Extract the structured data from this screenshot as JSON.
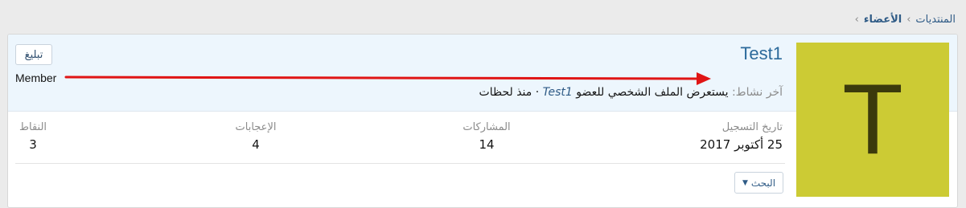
{
  "breadcrumb": {
    "items": [
      {
        "label": "المنتديات"
      },
      {
        "label": "الأعضاء"
      }
    ],
    "separator": "›"
  },
  "profile": {
    "avatar_letter": "T",
    "avatar_color": "#cccb34",
    "username": "Test1",
    "title": "Member",
    "report_label": "تبليغ",
    "last_activity": {
      "label": "آخر نشاط:",
      "action": "يستعرض الملف الشخصي للعضو",
      "member": "Test1",
      "separator": "·",
      "time": "منذ لحظات"
    }
  },
  "stats": {
    "registered": {
      "label": "تاريخ التسجيل",
      "value": "25 أكتوبر 2017"
    },
    "posts": {
      "label": "المشاركات",
      "value": "14"
    },
    "likes": {
      "label": "الإعجابات",
      "value": "4"
    },
    "points": {
      "label": "النقاط",
      "value": "3"
    }
  },
  "search_label": "البحث",
  "annotation_color": "#e01515"
}
